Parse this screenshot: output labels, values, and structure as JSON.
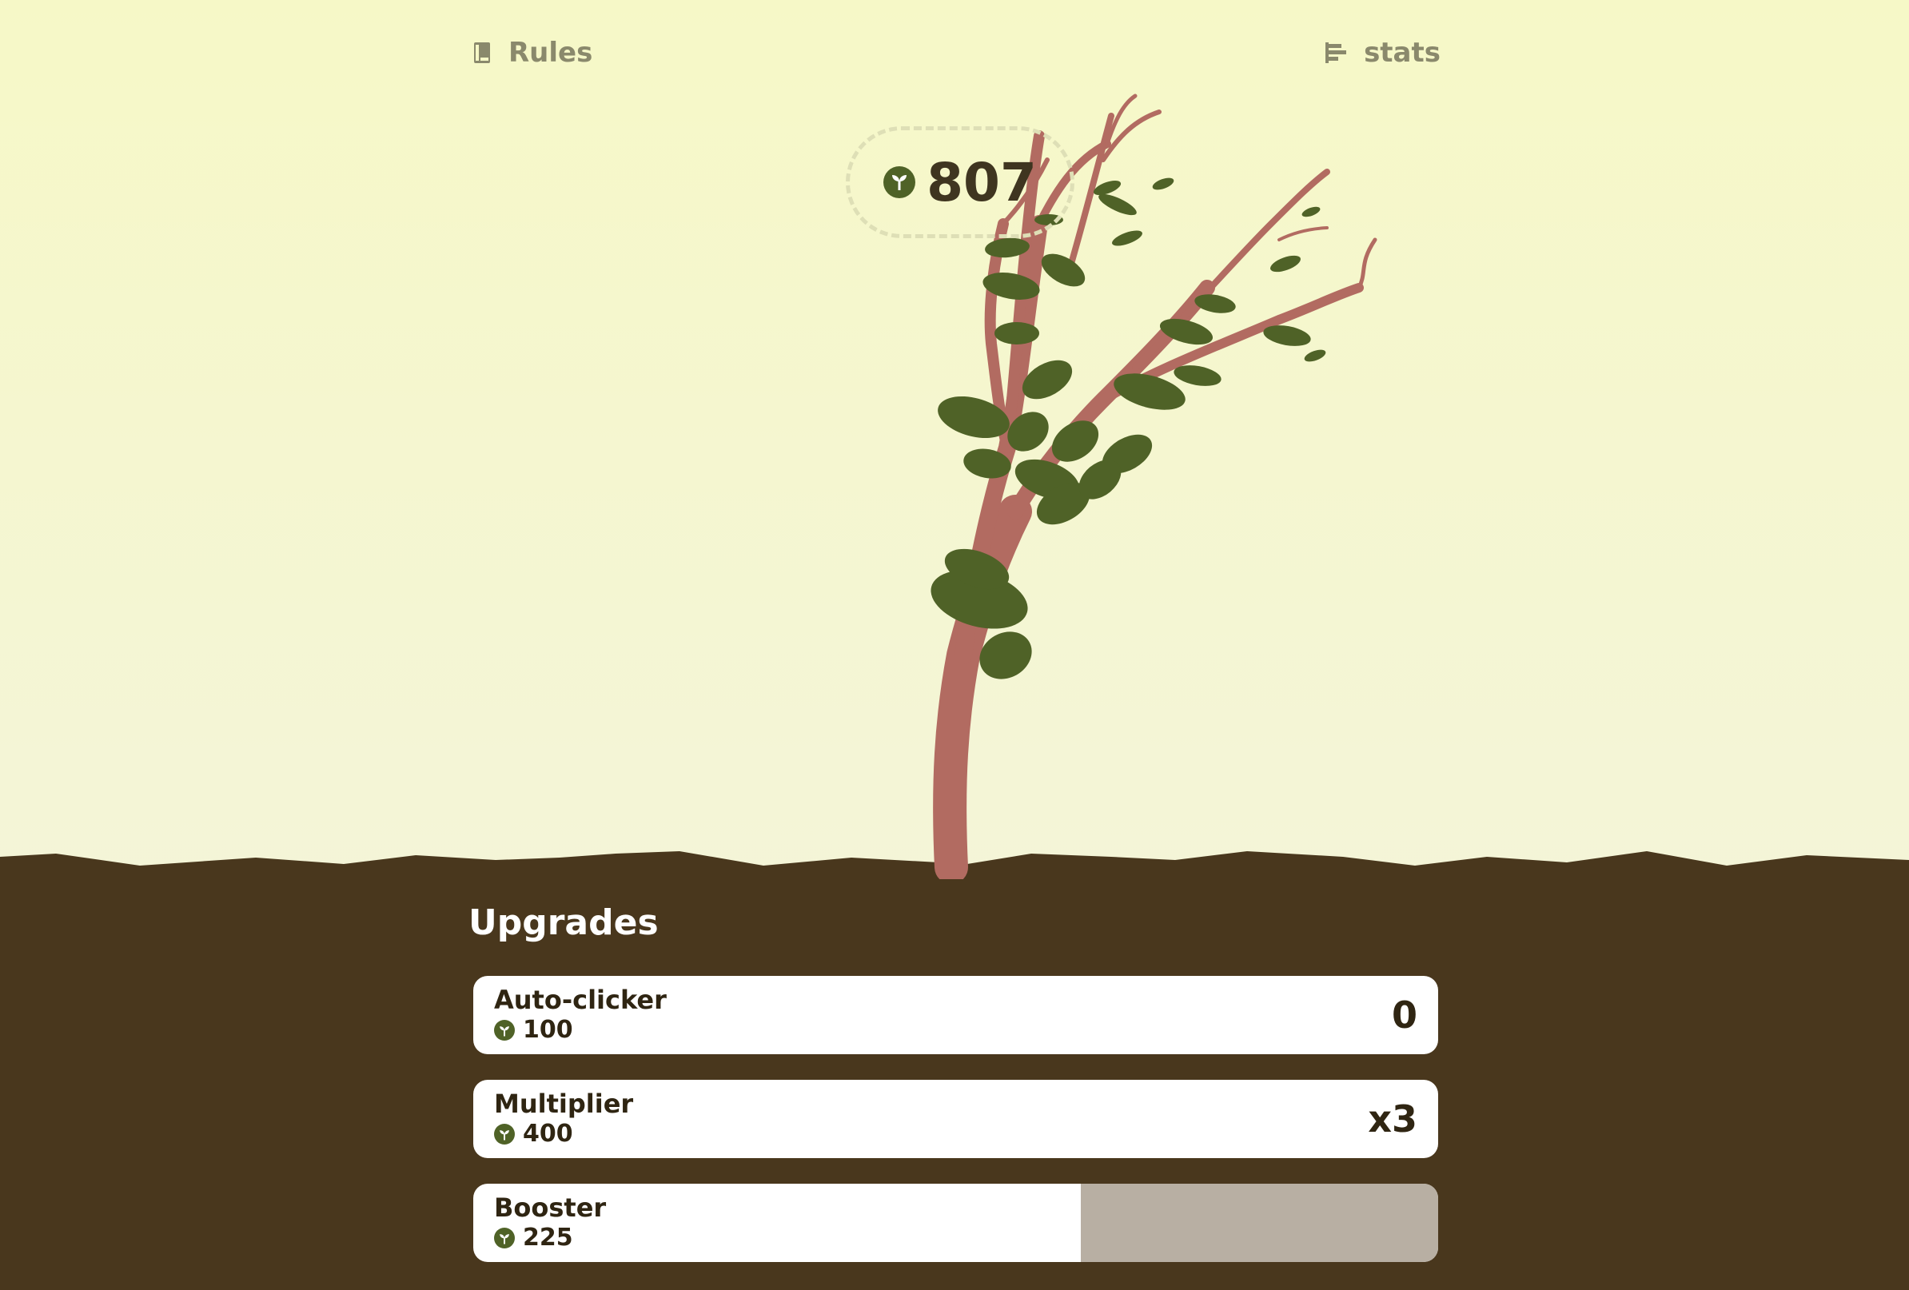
{
  "topbar": {
    "rules_label": "Rules",
    "stats_label": "stats",
    "rules_icon": "book-icon",
    "stats_icon": "bars-icon"
  },
  "score": {
    "value": "807",
    "icon": "sprout-coin-icon"
  },
  "upgrades": {
    "title": "Upgrades",
    "items": [
      {
        "name": "Auto-clicker",
        "cost": "100",
        "level": "0"
      },
      {
        "name": "Multiplier",
        "cost": "400",
        "level": "x3"
      },
      {
        "name": "Booster",
        "cost": "225",
        "level": "",
        "cooldown_remaining_fraction": 0.37
      }
    ]
  },
  "colors": {
    "sky_top": "#f6f8c7",
    "soil": "#49371d",
    "trunk": "#b26b61",
    "leaf": "#4f6227",
    "card": "#ffffff",
    "cooldown": "#b8afa3",
    "text_dark": "#2f2512",
    "topbar_text": "#8a896c"
  }
}
